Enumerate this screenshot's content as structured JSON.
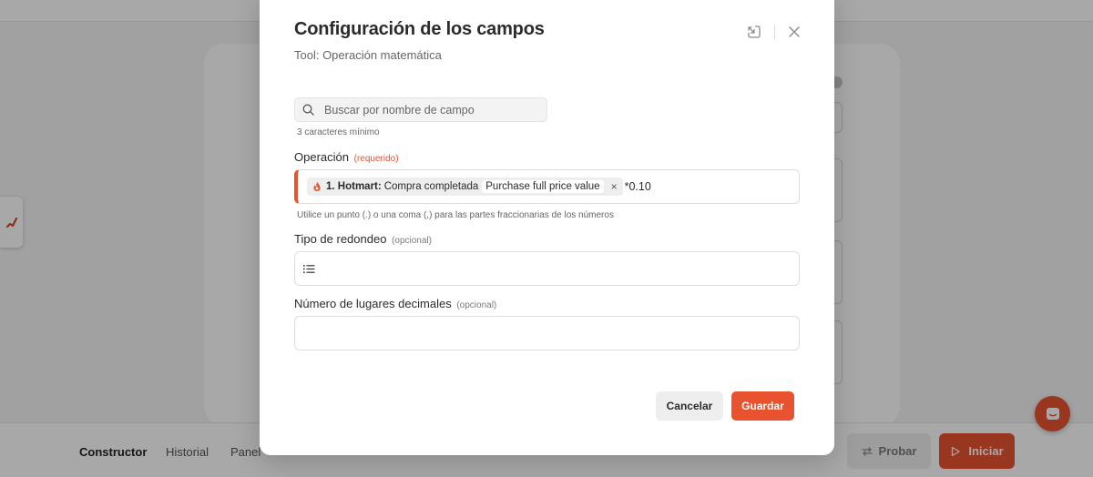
{
  "app": {
    "bottom_tabs": [
      "Constructor",
      "Historial",
      "Panel"
    ],
    "probar_label": "Probar",
    "iniciar_label": "Iniciar",
    "accent_color": "#e8522f"
  },
  "modal": {
    "title": "Configuración de los campos",
    "subtitle": "Tool: Operación matemática",
    "icons": [
      "open-external-icon",
      "close-icon"
    ],
    "search": {
      "placeholder": "Buscar por nombre de campo",
      "value": "",
      "hint": "3 caracteres mínimo"
    },
    "operation": {
      "label": "Operación",
      "tag": "(requerido)",
      "chip": {
        "icon": "hotmart-flame-icon",
        "app": "1. Hotmart:",
        "event": "Compra completada",
        "variable": "Purchase full price value",
        "remove": "×"
      },
      "suffix": "*0.10",
      "hint": "Utilice un punto (.) o una coma (,) para las partes fraccionarias de los números"
    },
    "rounding": {
      "label": "Tipo de redondeo",
      "tag": "(opcional)",
      "icon": "list-icon",
      "value": ""
    },
    "decimals": {
      "label": "Número de lugares decimales",
      "tag": "(opcional)",
      "value": ""
    },
    "cancel_label": "Cancelar",
    "save_label": "Guardar"
  }
}
